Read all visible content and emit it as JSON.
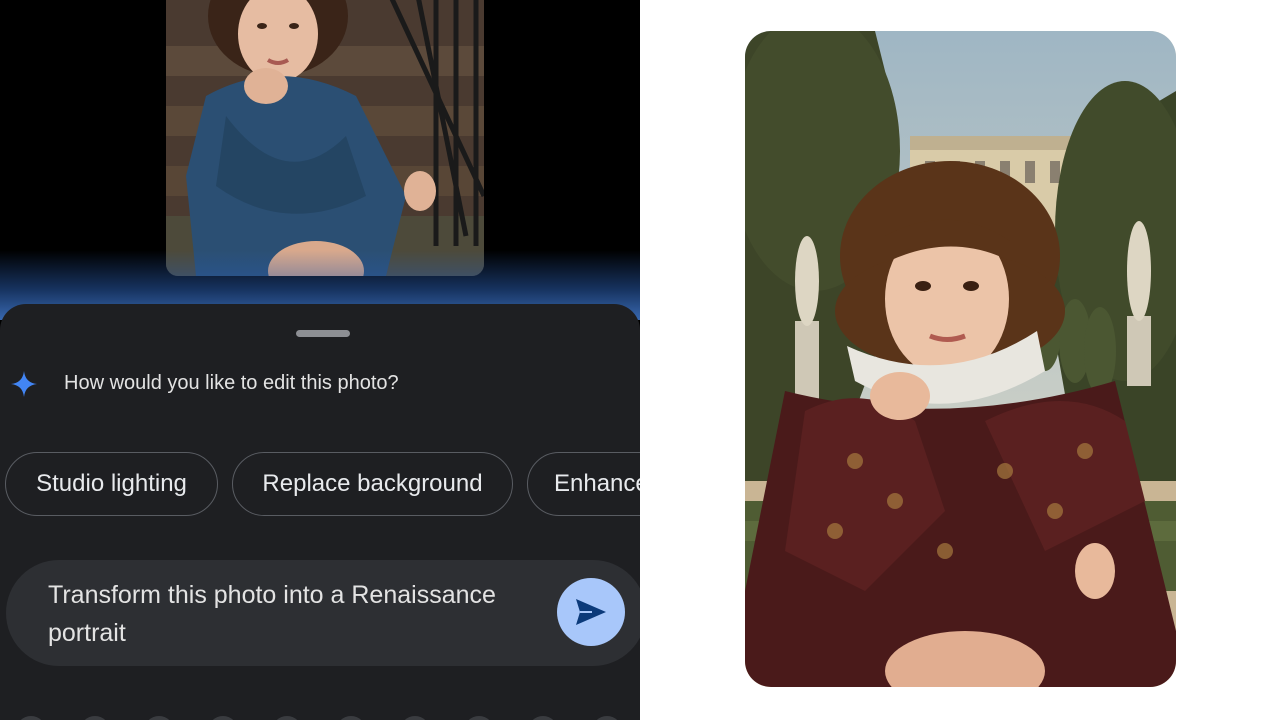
{
  "editor": {
    "prompt_question": "How would you like to edit this photo?",
    "suggestions": [
      {
        "label": "Studio lighting"
      },
      {
        "label": "Replace background"
      },
      {
        "label": "Enhance"
      }
    ],
    "input_value": "Transform this photo into a Renaissance portrait",
    "sparkle_icon": "sparkle-icon",
    "send_icon": "send-icon"
  },
  "colors": {
    "sheet_bg": "#1e1f22",
    "input_bg": "#2d2f33",
    "send_button": "#a8c7fa",
    "send_arrow": "#0b3a7a",
    "sparkle": "#4285f4"
  }
}
